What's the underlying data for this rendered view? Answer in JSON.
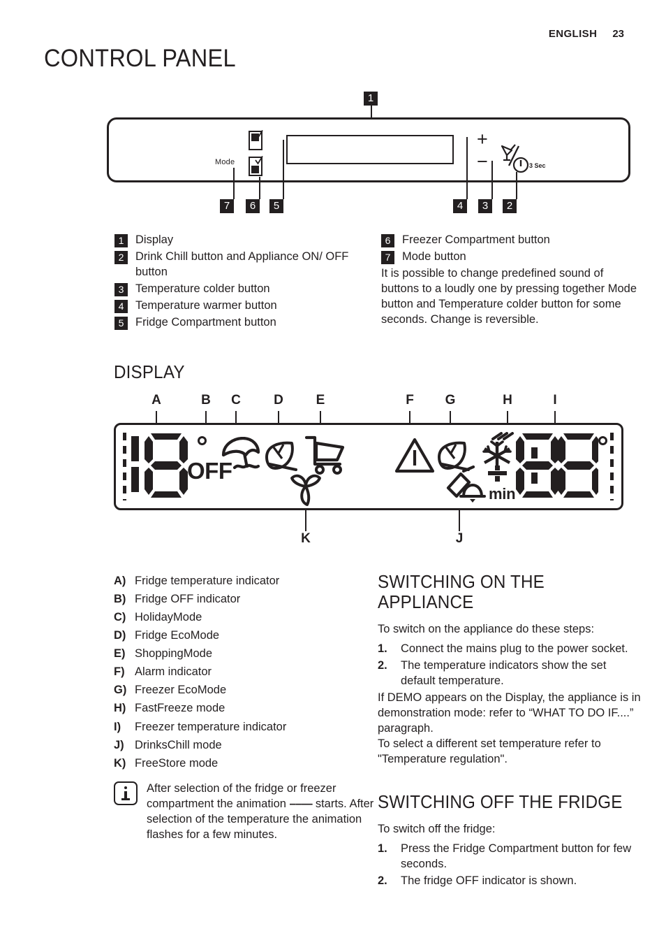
{
  "header": {
    "language": "ENGLISH",
    "page_number": "23"
  },
  "title": "CONTROL PANEL",
  "control_panel": {
    "mode_label": "Mode",
    "plus_symbol": "+",
    "minus_symbol": "−",
    "hold_label": "3 Sec",
    "callouts": [
      "1",
      "2",
      "3",
      "4",
      "5",
      "6",
      "7"
    ]
  },
  "legend_left": [
    {
      "num": "1",
      "text": "Display"
    },
    {
      "num": "2",
      "text": "Drink Chill button and Appliance ON/ OFF button"
    },
    {
      "num": "3",
      "text": "Temperature colder button"
    },
    {
      "num": "4",
      "text": "Temperature warmer button"
    },
    {
      "num": "5",
      "text": "Fridge Compartment button"
    }
  ],
  "legend_right": [
    {
      "num": "6",
      "text": "Freezer Compartment button"
    },
    {
      "num": "7",
      "text": "Mode button"
    }
  ],
  "legend_right_note": "It is possible to change predefined sound of buttons to a loudly one by pressing together Mode button and Temperature colder button for some seconds. Change is reversible.",
  "display_section": {
    "heading": "DISPLAY",
    "fridge_value": "18",
    "off_text": "OFF",
    "freezer_value": "88",
    "min_text": "min",
    "top_labels": [
      "A",
      "B",
      "C",
      "D",
      "E",
      "F",
      "G",
      "H",
      "I"
    ],
    "bottom_labels": [
      "K",
      "J"
    ]
  },
  "display_legend": [
    {
      "key": "A)",
      "text": "Fridge temperature indicator"
    },
    {
      "key": "B)",
      "text": "Fridge OFF indicator"
    },
    {
      "key": "C)",
      "text": "HolidayMode"
    },
    {
      "key": "D)",
      "text": "Fridge EcoMode"
    },
    {
      "key": "E)",
      "text": "ShoppingMode"
    },
    {
      "key": "F)",
      "text": "Alarm indicator"
    },
    {
      "key": "G)",
      "text": "Freezer EcoMode"
    },
    {
      "key": "H)",
      "text": "FastFreeze mode"
    },
    {
      "key": "I)",
      "text": "Freezer temperature indicator"
    },
    {
      "key": "J)",
      "text": "DrinksChill mode"
    },
    {
      "key": "K)",
      "text": "FreeStore mode"
    }
  ],
  "info_note": {
    "line1": "After selection of the fridge or freezer compartment the animation",
    "dashes": "––––",
    "line2": " starts.",
    "line3": "After selection of the temperature the animation flashes for a few minutes."
  },
  "switch_on": {
    "heading": "SWITCHING ON THE APPLIANCE",
    "intro": "To switch on the appliance do these steps:",
    "steps": [
      {
        "n": "1.",
        "text": "Connect the mains plug to the power socket."
      },
      {
        "n": "2.",
        "text": "The temperature indicators show the set default temperature."
      }
    ],
    "para1": "If DEMO appears on the Display, the appliance is in demonstration mode: refer to “WHAT TO DO IF....” paragraph.",
    "para2": "To select a different set temperature refer to \"Temperature regulation\"."
  },
  "switch_off": {
    "heading": "SWITCHING OFF THE FRIDGE",
    "intro": "To switch off the fridge:",
    "steps": [
      {
        "n": "1.",
        "text": "Press the Fridge Compartment button for few seconds."
      },
      {
        "n": "2.",
        "text": "The fridge OFF indicator is shown."
      }
    ]
  },
  "colors": {
    "ink": "#231f20",
    "paper": "#ffffff"
  }
}
